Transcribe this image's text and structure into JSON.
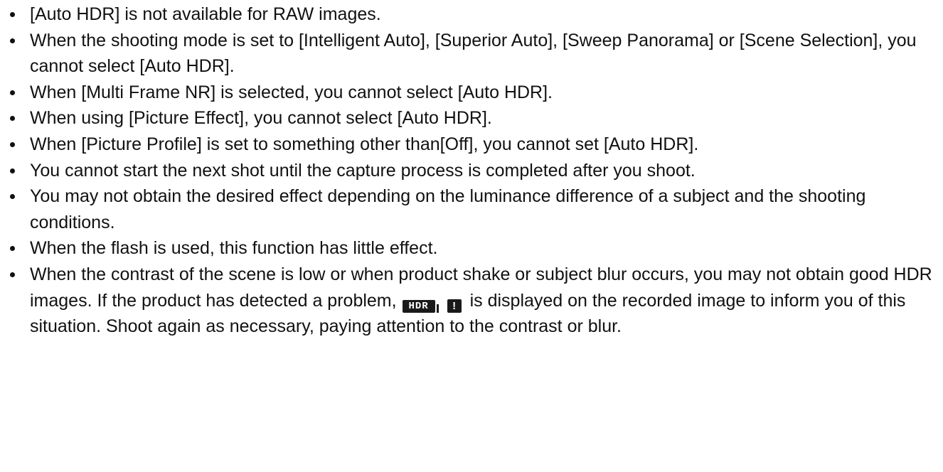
{
  "notes": [
    {
      "text": "[Auto HDR] is not available for RAW images."
    },
    {
      "text": "When the shooting mode is set to [Intelligent Auto], [Superior Auto], [Sweep Panorama] or [Scene Selection], you cannot select [Auto HDR]."
    },
    {
      "text": "When [Multi Frame NR] is selected, you cannot select [Auto HDR]."
    },
    {
      "text": "When using [Picture Effect], you cannot select [Auto HDR]."
    },
    {
      "text": "When [Picture Profile] is set to something other than[Off], you cannot set [Auto HDR]."
    },
    {
      "text": "You cannot start the next shot until the capture process is completed after you shoot."
    },
    {
      "text": "You may not obtain the desired effect depending on the luminance difference of a subject and the shooting conditions."
    },
    {
      "text": "When the flash is used, this function has little effect."
    },
    {
      "text_before_icon": "When the contrast of the scene is low or when product shake or subject blur occurs, you may not obtain good HDR images. If the product has detected a problem,",
      "icon": {
        "name": "hdr-warning-icon",
        "hdr_label": "HDR",
        "warn_label": "!"
      },
      "text_after_icon": "is displayed on the recorded image to inform you of this situation. Shoot again as necessary, paying attention to the contrast or blur."
    }
  ]
}
